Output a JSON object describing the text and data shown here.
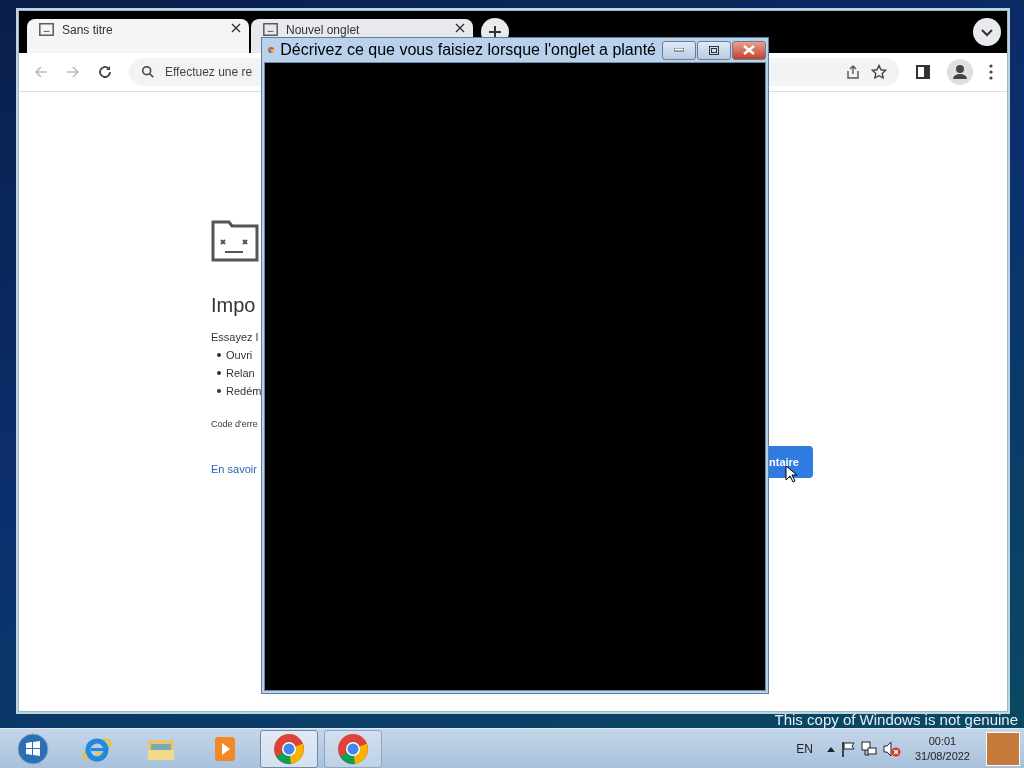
{
  "browser": {
    "tabs": [
      {
        "label": "Sans titre",
        "selected": true
      },
      {
        "label": "Nouvel onglet",
        "selected": false
      }
    ],
    "address_bar": {
      "placeholder": "Effectuez une re"
    },
    "error_page": {
      "heading": "Impo",
      "intro": "Essayez l",
      "suggestions": [
        "Ouvri",
        "Relan",
        "Redém"
      ],
      "error_code": "Code d'erre",
      "link": "En savoir",
      "button": "ntaire"
    }
  },
  "dialog": {
    "title": "Décrivez ce que vous faisiez lorsque l'onglet a planté"
  },
  "desktop": {
    "notice": "This copy of Windows is not genuine"
  },
  "taskbar": {
    "apps": [
      {
        "kind": "start",
        "selected": false
      },
      {
        "kind": "ie",
        "selected": false
      },
      {
        "kind": "explorer",
        "selected": false
      },
      {
        "kind": "media",
        "selected": false
      },
      {
        "kind": "chrome",
        "selected": true
      },
      {
        "kind": "chrome",
        "selected": false
      }
    ],
    "language": "EN",
    "time": "00:01",
    "date": "31/08/2022"
  }
}
